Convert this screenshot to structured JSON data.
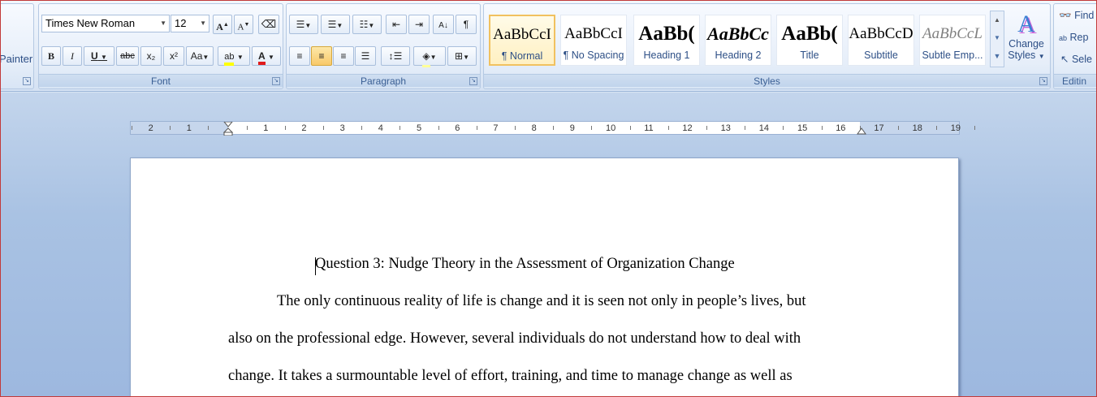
{
  "clipboard": {
    "painter_label": "Painter"
  },
  "font": {
    "group_label": "Font",
    "family_value": "Times New Roman",
    "size_value": "12",
    "buttons": {
      "bold": "B",
      "italic": "I",
      "underline": "U",
      "strike": "abc",
      "subscript": "x₂",
      "superscript": "x²",
      "change_case": "Aa",
      "highlight": "ab",
      "font_color": "A",
      "grow": "A",
      "shrink": "A"
    }
  },
  "paragraph": {
    "group_label": "Paragraph",
    "show_marks": "¶"
  },
  "styles": {
    "group_label": "Styles",
    "items": [
      {
        "sample": "AaBbCcI",
        "name": "¶ Normal"
      },
      {
        "sample": "AaBbCcI",
        "name": "¶ No Spacing"
      },
      {
        "sample": "AaBb(",
        "name": "Heading 1"
      },
      {
        "sample": "AaBbCc",
        "name": "Heading 2"
      },
      {
        "sample": "AaBb(",
        "name": "Title"
      },
      {
        "sample": "AaBbCcD",
        "name": "Subtitle"
      },
      {
        "sample": "AaBbCcL",
        "name": "Subtle Emp..."
      }
    ],
    "change_styles_line1": "Change",
    "change_styles_line2": "Styles"
  },
  "editing": {
    "group_label": "Editin",
    "find": "Find",
    "replace": "Rep",
    "select": "Sele"
  },
  "ruler": {
    "ticks": [
      "2",
      "1",
      "1",
      "2",
      "3",
      "4",
      "5",
      "6",
      "7",
      "8",
      "9",
      "10",
      "11",
      "12",
      "13",
      "14",
      "15",
      "16",
      "17",
      "18",
      "19"
    ]
  },
  "document": {
    "title": "Question 3: Nudge Theory in the Assessment of Organization Change",
    "line1": "The only continuous reality of life is change and it is seen not only in people’s lives, but",
    "line2": "also on the professional edge. However, several individuals do not understand how to deal with",
    "line3": "change. It takes a surmountable level of effort, training, and time to manage change as well as"
  }
}
